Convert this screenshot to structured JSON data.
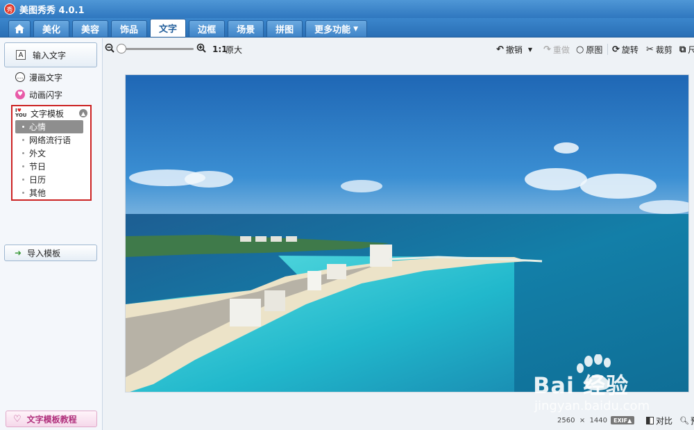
{
  "app": {
    "title": "美图秀秀 4.0.1",
    "logo_char": "秀"
  },
  "tabs": [
    {
      "label": "",
      "icon": "home-icon"
    },
    {
      "label": "美化"
    },
    {
      "label": "美容"
    },
    {
      "label": "饰品"
    },
    {
      "label": "文字",
      "active": true
    },
    {
      "label": "边框"
    },
    {
      "label": "场景"
    },
    {
      "label": "拼图"
    },
    {
      "label": "更多功能"
    }
  ],
  "left": {
    "input_text": "输入文字",
    "comic_text": "漫画文字",
    "anim_text": "动画闪字",
    "templates": {
      "title": "文字模板",
      "items": [
        "心情",
        "网络流行语",
        "外文",
        "节日",
        "日历",
        "其他"
      ],
      "selected": "心情"
    },
    "import_template": "导入模板",
    "tutorial": "文字模板教程"
  },
  "toolbar": {
    "ratio": "1:1",
    "original_size": "原大",
    "undo": "撤销",
    "redo": "重做",
    "original": "原图",
    "rotate": "旋转",
    "crop": "裁剪",
    "more": "尺"
  },
  "status": {
    "width": "2560",
    "times": "×",
    "height": "1440",
    "exif": "EXIF▲",
    "compare": "对比",
    "preview": "预"
  },
  "watermark": {
    "brand": "Bai  经验",
    "url": "jingyan.baidu.com"
  },
  "colors": {
    "titlebar": "#2f77bf",
    "template_border": "#cc2222",
    "sea": "#1fb4c9",
    "sky": "#2b79c2"
  }
}
